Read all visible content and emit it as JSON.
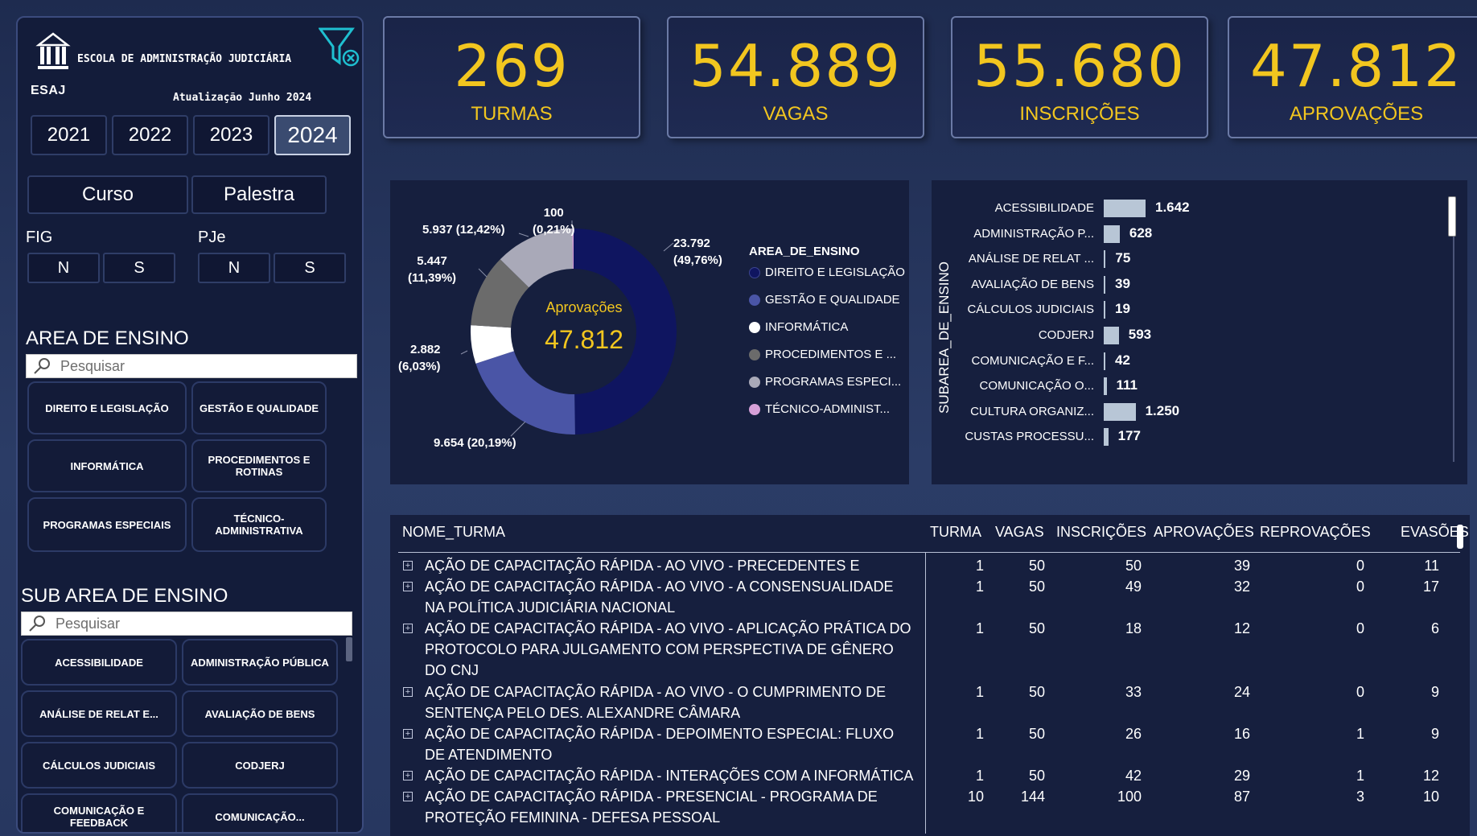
{
  "sidebar": {
    "logo_text": "ESAJ",
    "org_name": "ESCOLA DE ADMINISTRAÇÃO JUDICIÁRIA",
    "update_text": "Atualização Junho 2024",
    "years": [
      "2021",
      "2022",
      "2023",
      "2024"
    ],
    "selected_year": "2024",
    "types": [
      "Curso",
      "Palestra"
    ],
    "fig_label": "FIG",
    "pje_label": "PJe",
    "fig_options": [
      "N",
      "S"
    ],
    "pje_options": [
      "N",
      "S"
    ],
    "area_title": "AREA DE ENSINO",
    "area_search_placeholder": "Pesquisar",
    "area_items": [
      "DIREITO E LEGISLAÇÃO",
      "GESTÃO E QUALIDADE",
      "INFORMÁTICA",
      "PROCEDIMENTOS E ROTINAS",
      "PROGRAMAS ESPECIAIS",
      "TÉCNICO-ADMINISTRATIVA"
    ],
    "subarea_title": "SUB AREA DE ENSINO",
    "subarea_search_placeholder": "Pesquisar",
    "subarea_items": [
      "ACESSIBILIDADE",
      "ADMINISTRAÇÃO PÚBLICA",
      "ANÁLISE DE RELAT E...",
      "AVALIAÇÃO DE BENS",
      "CÁLCULOS JUDICIAIS",
      "CODJERJ",
      "COMUNICAÇÃO E FEEDBACK",
      "COMUNICAÇÃO..."
    ]
  },
  "kpis": [
    {
      "value": "269",
      "label": "TURMAS"
    },
    {
      "value": "54.889",
      "label": "VAGAS"
    },
    {
      "value": "55.680",
      "label": "INSCRIÇÕES"
    },
    {
      "value": "47.812",
      "label": "APROVAÇÕES"
    }
  ],
  "colors": {
    "accent_gold": "#f2c61f",
    "direito": "#0f1560",
    "gestao": "#4a55a6",
    "informatica": "#ffffff",
    "procedimentos": "#6b6b6b",
    "programas": "#a9a9b8",
    "tecnico": "#d6a0d8"
  },
  "chart_data": [
    {
      "type": "pie",
      "center_label": "Aprovações",
      "center_value": "47.812",
      "legend_title": "AREA_DE_ENSINO",
      "legend": [
        "DIREITO E LEGISLAÇÃO",
        "GESTÃO E QUALIDADE",
        "INFORMÁTICA",
        "PROCEDIMENTOS E ...",
        "PROGRAMAS ESPECI...",
        "TÉCNICO-ADMINIST..."
      ],
      "slices": [
        {
          "category": "DIREITO E LEGISLAÇÃO",
          "value": 23792,
          "label": "23.792\n(49,76%)"
        },
        {
          "category": "GESTÃO E QUALIDADE",
          "value": 9654,
          "label": "9.654 (20,19%)"
        },
        {
          "category": "INFORMÁTICA",
          "value": 2882,
          "label": "2.882\n(6,03%)"
        },
        {
          "category": "PROCEDIMENTOS E ...",
          "value": 5447,
          "label": "5.447\n(11,39%)"
        },
        {
          "category": "PROGRAMAS ESPECI...",
          "value": 5937,
          "label": "5.937 (12,42%)"
        },
        {
          "category": "TÉCNICO-ADMINIST...",
          "value": 100,
          "label": "100\n(0,21%)"
        }
      ]
    },
    {
      "type": "bar",
      "orientation": "horizontal",
      "ylabel": "SUBAREA_DE_ENSINO",
      "categories": [
        "ACESSIBILIDADE",
        "ADMINISTRAÇÃO P...",
        "ANÁLISE DE RELAT ...",
        "AVALIAÇÃO DE BENS",
        "CÁLCULOS JUDICIAIS",
        "CODJERJ",
        "COMUNICAÇÃO E F...",
        "COMUNICAÇÃO O...",
        "CULTURA ORGANIZ...",
        "CUSTAS PROCESSU..."
      ],
      "values": [
        1642,
        628,
        75,
        39,
        19,
        593,
        42,
        111,
        1250,
        177
      ],
      "value_labels": [
        "1.642",
        "628",
        "75",
        "39",
        "19",
        "593",
        "42",
        "111",
        "1.250",
        "177"
      ]
    },
    {
      "type": "table",
      "columns": [
        "NOME_TURMA",
        "TURMA",
        "VAGAS",
        "INSCRIÇÕES",
        "APROVAÇÕES",
        "REPROVAÇÕES",
        "EVASÕES"
      ],
      "rows": [
        {
          "name": "AÇÃO DE CAPACITAÇÃO RÁPIDA - AO VIVO - PRECEDENTES E",
          "turma": "1",
          "vagas": "50",
          "inscricoes": "50",
          "aprovacoes": "39",
          "reprovacoes": "0",
          "evasoes": "11"
        },
        {
          "name": "AÇÃO DE CAPACITAÇÃO RÁPIDA - AO VIVO - A CONSENSUALIDADE NA POLÍTICA JUDICIÁRIA NACIONAL",
          "turma": "1",
          "vagas": "50",
          "inscricoes": "49",
          "aprovacoes": "32",
          "reprovacoes": "0",
          "evasoes": "17"
        },
        {
          "name": "AÇÃO DE CAPACITAÇÃO RÁPIDA - AO VIVO - APLICAÇÃO PRÁTICA DO PROTOCOLO PARA JULGAMENTO COM PERSPECTIVA DE GÊNERO DO CNJ",
          "turma": "1",
          "vagas": "50",
          "inscricoes": "18",
          "aprovacoes": "12",
          "reprovacoes": "0",
          "evasoes": "6"
        },
        {
          "name": "AÇÃO DE CAPACITAÇÃO RÁPIDA - AO VIVO - O CUMPRIMENTO DE SENTENÇA PELO DES. ALEXANDRE CÂMARA",
          "turma": "1",
          "vagas": "50",
          "inscricoes": "33",
          "aprovacoes": "24",
          "reprovacoes": "0",
          "evasoes": "9"
        },
        {
          "name": "AÇÃO DE CAPACITAÇÃO RÁPIDA - DEPOIMENTO ESPECIAL: FLUXO DE ATENDIMENTO",
          "turma": "1",
          "vagas": "50",
          "inscricoes": "26",
          "aprovacoes": "16",
          "reprovacoes": "1",
          "evasoes": "9"
        },
        {
          "name": "AÇÃO DE CAPACITAÇÃO RÁPIDA - INTERAÇÕES COM A INFORMÁTICA",
          "turma": "1",
          "vagas": "50",
          "inscricoes": "42",
          "aprovacoes": "29",
          "reprovacoes": "1",
          "evasoes": "12"
        },
        {
          "name": "AÇÃO DE CAPACITAÇÃO RÁPIDA - PRESENCIAL - PROGRAMA DE PROTEÇÃO FEMININA - DEFESA PESSOAL",
          "turma": "10",
          "vagas": "144",
          "inscricoes": "100",
          "aprovacoes": "87",
          "reprovacoes": "3",
          "evasoes": "10"
        }
      ]
    }
  ]
}
